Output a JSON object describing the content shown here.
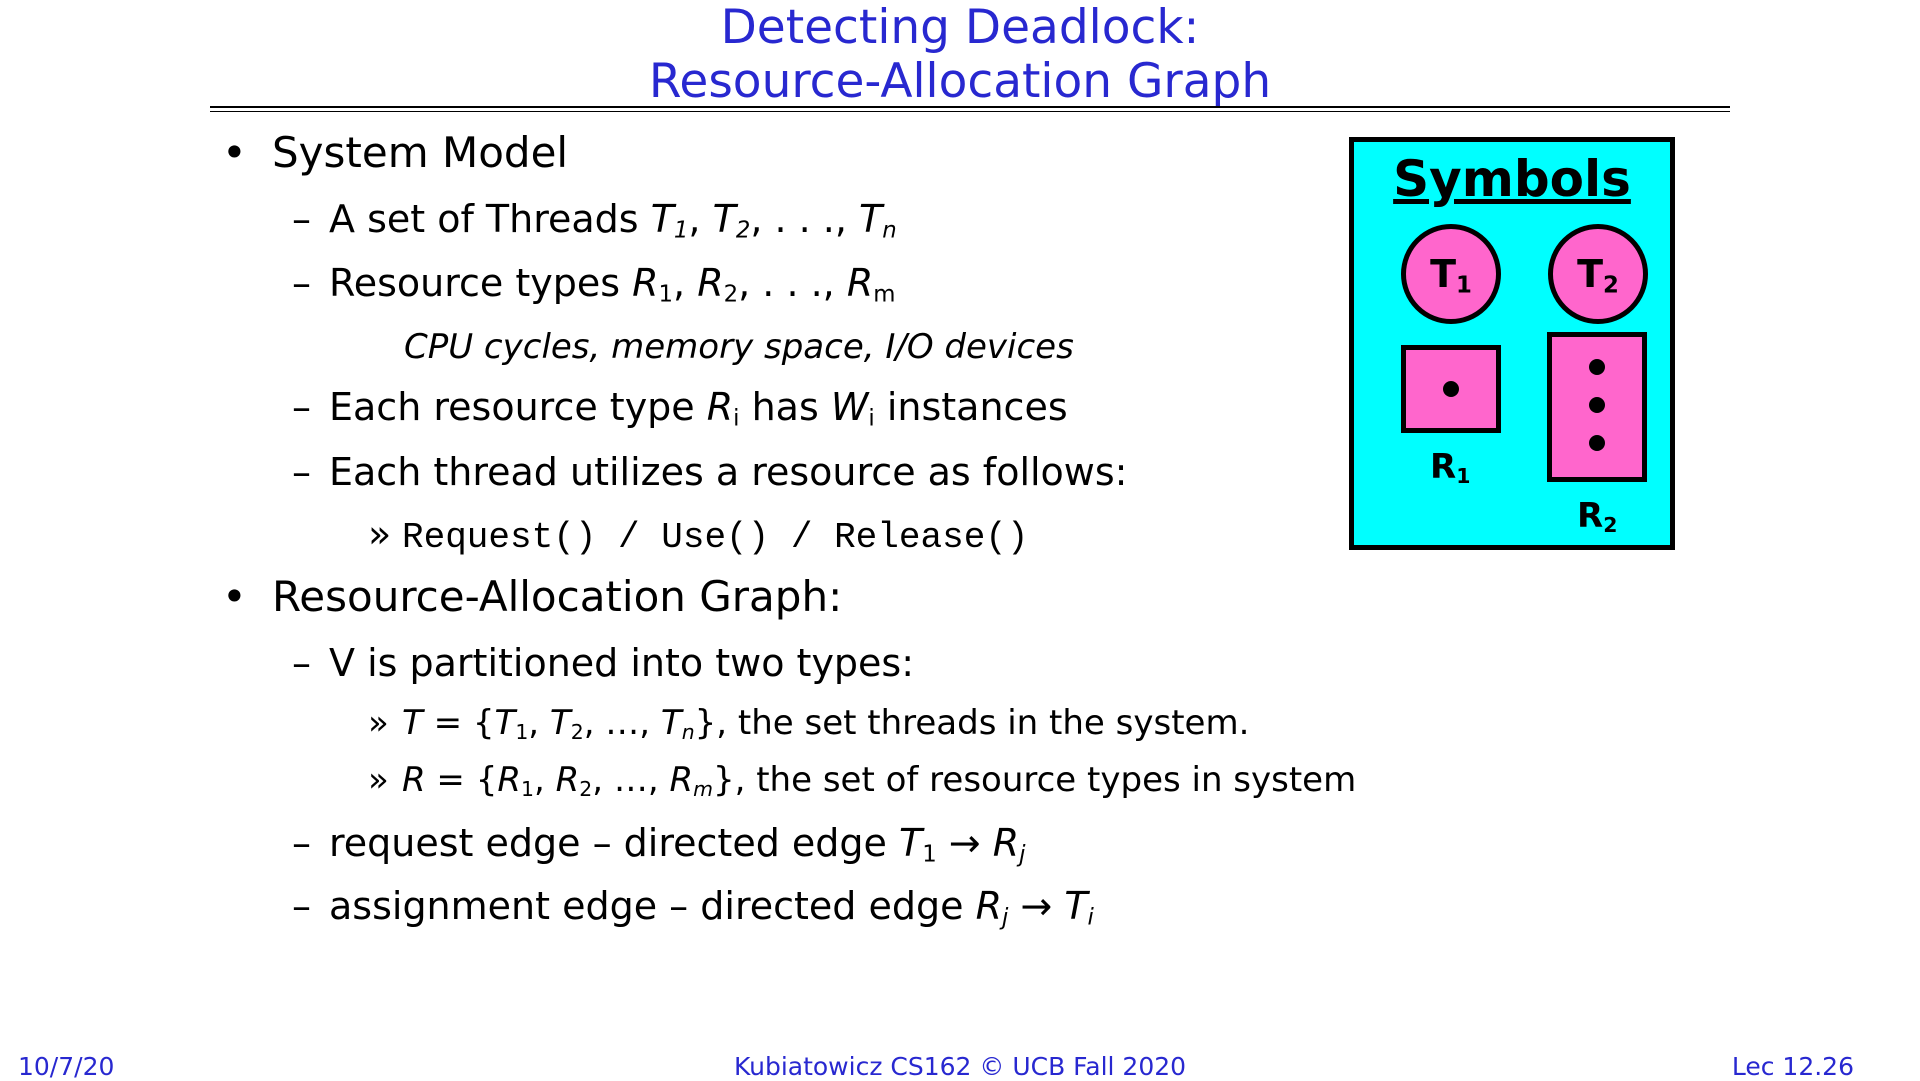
{
  "slide": {
    "title_line1": "Detecting Deadlock:",
    "title_line2": "Resource-Allocation Graph",
    "bullet1": "System Model",
    "sub1_prefix": "A set of Threads ",
    "sub2_prefix": "Resource types ",
    "examples": "CPU cycles, memory space, I/O devices",
    "sub3_a": "Each resource type ",
    "sub3_b": " has ",
    "sub3_c": " instances",
    "sub4": "Each thread utilizes a resource as follows:",
    "code": "Request() / Use() / Release()",
    "bullet2": "Resource-Allocation Graph:",
    "sub5": "V is partitioned into two types:",
    "sub6_suffix": ", the set threads in the system.",
    "sub7_suffix": ", the set of resource types in system",
    "sub8_prefix": "request edge – directed edge ",
    "sub9_prefix": "assignment edge – directed edge "
  },
  "symbols": {
    "title": "Symbols",
    "thread1": "T1",
    "thread2": "T2",
    "resource1": "R1",
    "resource2": "R2",
    "resource1_instances": 1,
    "resource2_instances": 3,
    "fill_color": "#ff66cc",
    "box_color": "#00ffff"
  },
  "footer": {
    "date": "10/7/20",
    "course": "Kubiatowicz CS162 © UCB Fall 2020",
    "lecture": "Lec 12.26"
  },
  "colors": {
    "title": "#2828d0"
  }
}
